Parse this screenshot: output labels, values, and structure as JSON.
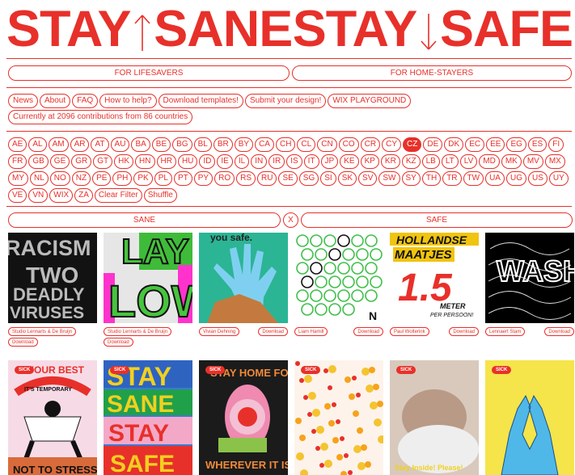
{
  "logo": {
    "word1": "STAY",
    "word2": "SANE",
    "word3": "STAY",
    "word4": "SAFE",
    "up_arrow_icon": "arrow-up-icon",
    "down_arrow_icon": "arrow-down-icon"
  },
  "audience": {
    "left": "FOR LIFESAVERS",
    "right": "FOR HOME-STAYERS"
  },
  "nav": [
    "News",
    "About",
    "FAQ",
    "How to help?",
    "Download templates!",
    "Submit your design!",
    "WIX PLAYGROUND"
  ],
  "contributions": "Currently at 2096 contributions from 86 countries",
  "countries": [
    "AE",
    "AL",
    "AM",
    "AR",
    "AT",
    "AU",
    "BA",
    "BE",
    "BG",
    "BL",
    "BR",
    "BY",
    "CA",
    "CH",
    "CL",
    "CN",
    "CO",
    "CR",
    "CY",
    "CZ",
    "DE",
    "DK",
    "EC",
    "EE",
    "EG",
    "ES",
    "FI",
    "FR",
    "GB",
    "GE",
    "GR",
    "GT",
    "HK",
    "HN",
    "HR",
    "HU",
    "ID",
    "IE",
    "IL",
    "IN",
    "IR",
    "IS",
    "IT",
    "JP",
    "KE",
    "KP",
    "KR",
    "KZ",
    "LB",
    "LT",
    "LV",
    "MD",
    "MK",
    "MV",
    "MX",
    "MY",
    "NL",
    "NO",
    "NZ",
    "PE",
    "PH",
    "PK",
    "PL",
    "PT",
    "PY",
    "RO",
    "RS",
    "RU",
    "SE",
    "SG",
    "SI",
    "SK",
    "SV",
    "SW",
    "SY",
    "TH",
    "TR",
    "TW",
    "UA",
    "UG",
    "US",
    "UY",
    "VE",
    "VN",
    "WIX",
    "ZA"
  ],
  "active_country": "CZ",
  "filter_actions": {
    "clear": "Clear Filter",
    "shuffle": "Shuffle"
  },
  "toggle": {
    "sane": "SANE",
    "x": "X",
    "safe": "SAFE"
  },
  "posters_row1": [
    {
      "author": "Studio Lennarts & De Bruijn",
      "download": "Download",
      "text": [
        "RACISM",
        "TWO",
        "DEADLY",
        "VIRUSES"
      ]
    },
    {
      "author": "Studio Lennarts & De Bruijn",
      "download": "Download",
      "text": [
        "LAY",
        "LOW"
      ]
    },
    {
      "author": "Vivian Dehning",
      "download": "Download",
      "text": [
        "you safe."
      ]
    },
    {
      "author": "Liam Hamill",
      "download": "Download",
      "text": [
        "N"
      ]
    },
    {
      "author": "Paul Wolterink",
      "download": "Download",
      "text": [
        "HOLLANDSE",
        "MAATJES",
        "1.5",
        "METER",
        "PER PERSOON!"
      ]
    },
    {
      "author": "Lennaert Stam",
      "download": "Download",
      "text": [
        "WASH"
      ]
    }
  ],
  "posters_row2": [
    {
      "badge": "SICK",
      "text": [
        "YOUR BEST",
        "IT'S TEMPORARY",
        "NOT TO STRESS"
      ]
    },
    {
      "badge": "SICK",
      "text": [
        "STAY",
        "SANE",
        "STAY",
        "SAFE"
      ]
    },
    {
      "badge": "SICK",
      "text": [
        "STAY HOME FOLKS",
        "WHEREVER IT IS!"
      ]
    },
    {
      "badge": "SICK",
      "text": []
    },
    {
      "badge": "SICK",
      "text": [
        "Stay Inside! Please!"
      ]
    },
    {
      "badge": "SICK",
      "text": []
    }
  ],
  "colors": {
    "accent": "#e8302a",
    "background": "#ffffff"
  }
}
